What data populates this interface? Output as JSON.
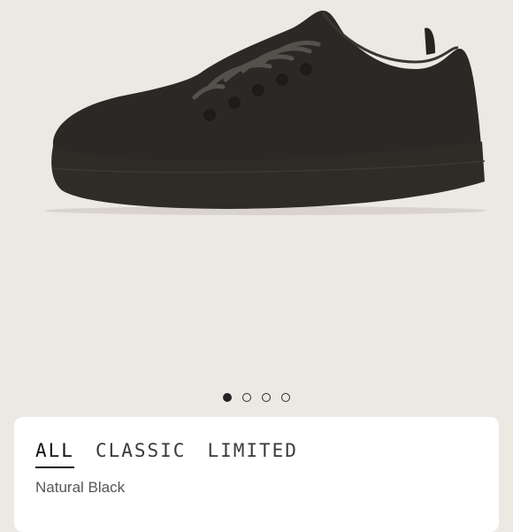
{
  "gallery": {
    "image_name": "sneaker-product-image",
    "dots": [
      {
        "active": true
      },
      {
        "active": false
      },
      {
        "active": false
      },
      {
        "active": false
      }
    ]
  },
  "tabs": [
    {
      "label": "ALL",
      "active": true
    },
    {
      "label": "CLASSIC",
      "active": false
    },
    {
      "label": "LIMITED",
      "active": false
    }
  ],
  "selected_color": "Natural Black",
  "colors": {
    "background": "#ece9e3",
    "card": "#ffffff",
    "shoe_upper": "#2b2826",
    "shoe_sole": "#2e2c27"
  }
}
